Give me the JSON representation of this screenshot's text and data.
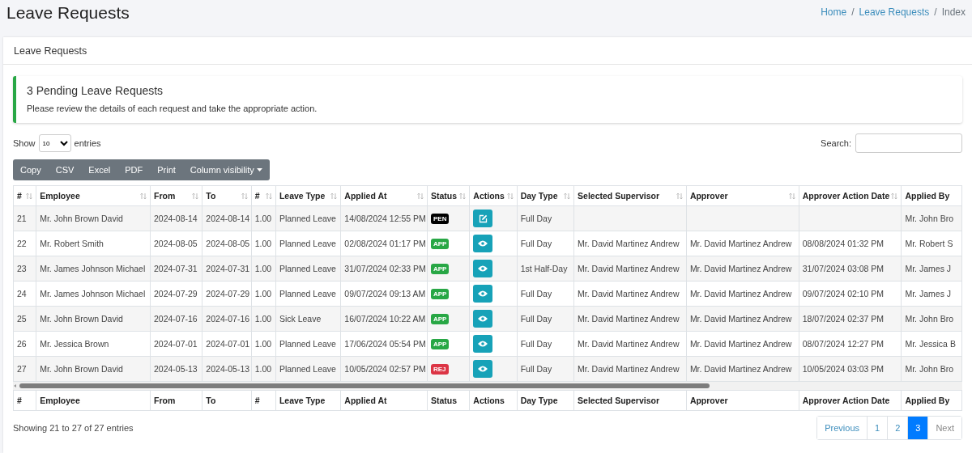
{
  "page_title": "Leave Requests",
  "breadcrumb": [
    {
      "label": "Home",
      "kind": "link"
    },
    {
      "label": "/",
      "kind": "separator"
    },
    {
      "label": "Leave Requests",
      "kind": "link"
    },
    {
      "label": "/",
      "kind": "separator"
    },
    {
      "label": "Index",
      "kind": "current"
    }
  ],
  "card": {
    "title": "Leave Requests"
  },
  "callout": {
    "title": "3 Pending Leave Requests",
    "text": "Please review the details of each request and take the appropriate action."
  },
  "length_menu": {
    "before": "Show",
    "value": "10",
    "after": "entries"
  },
  "search": {
    "label": "Search:"
  },
  "export_buttons": [
    {
      "label": "Copy",
      "kind": "plain"
    },
    {
      "label": "CSV",
      "kind": "plain"
    },
    {
      "label": "Excel",
      "kind": "plain"
    },
    {
      "label": "PDF",
      "kind": "plain"
    },
    {
      "label": "Print",
      "kind": "plain"
    },
    {
      "label": "Column visibility",
      "kind": "dropdown"
    }
  ],
  "table": {
    "columns": [
      {
        "label": "#",
        "sortable": true
      },
      {
        "label": "Employee",
        "sortable": true
      },
      {
        "label": "From",
        "sortable": true
      },
      {
        "label": "To",
        "sortable": true
      },
      {
        "label": "#",
        "sortable": true
      },
      {
        "label": "Leave Type",
        "sortable": true
      },
      {
        "label": "Applied At",
        "sortable": true
      },
      {
        "label": "Status",
        "sortable": true
      },
      {
        "label": "Actions",
        "sortable": true
      },
      {
        "label": "Day Type",
        "sortable": true
      },
      {
        "label": "Selected Supervisor",
        "sortable": true
      },
      {
        "label": "Approver",
        "sortable": true
      },
      {
        "label": "Approver Action Date",
        "sortable": true
      },
      {
        "label": "Applied By",
        "sortable": false
      }
    ],
    "rows": [
      {
        "id": "21",
        "employee": "Mr. John Brown David",
        "from": "2024-08-14",
        "to": "2024-08-14",
        "days": "1.00",
        "leave_type": "Planned Leave",
        "applied_at": "14/08/2024 12:55 PM",
        "status": {
          "label": "PEN",
          "kind": "pending"
        },
        "action": {
          "kind": "edit"
        },
        "day_type": "Full Day",
        "selected_supervisor": "",
        "approver": "",
        "approver_action_date": "",
        "applied_by": "Mr. John Bro"
      },
      {
        "id": "22",
        "employee": "Mr. Robert Smith",
        "from": "2024-08-05",
        "to": "2024-08-05",
        "days": "1.00",
        "leave_type": "Planned Leave",
        "applied_at": "02/08/2024 01:17 PM",
        "status": {
          "label": "APP",
          "kind": "approved"
        },
        "action": {
          "kind": "view"
        },
        "day_type": "Full Day",
        "selected_supervisor": "Mr. David Martinez Andrew",
        "approver": "Mr. David Martinez Andrew",
        "approver_action_date": "08/08/2024 01:32 PM",
        "applied_by": "Mr. Robert S"
      },
      {
        "id": "23",
        "employee": "Mr. James Johnson Michael",
        "from": "2024-07-31",
        "to": "2024-07-31",
        "days": "1.00",
        "leave_type": "Planned Leave",
        "applied_at": "31/07/2024 02:33 PM",
        "status": {
          "label": "APP",
          "kind": "approved"
        },
        "action": {
          "kind": "view"
        },
        "day_type": "1st Half-Day",
        "selected_supervisor": "Mr. David Martinez Andrew",
        "approver": "Mr. David Martinez Andrew",
        "approver_action_date": "31/07/2024 03:08 PM",
        "applied_by": "Mr. James J"
      },
      {
        "id": "24",
        "employee": "Mr. James Johnson Michael",
        "from": "2024-07-29",
        "to": "2024-07-29",
        "days": "1.00",
        "leave_type": "Planned Leave",
        "applied_at": "09/07/2024 09:13 AM",
        "status": {
          "label": "APP",
          "kind": "approved"
        },
        "action": {
          "kind": "view"
        },
        "day_type": "Full Day",
        "selected_supervisor": "Mr. David Martinez Andrew",
        "approver": "Mr. David Martinez Andrew",
        "approver_action_date": "09/07/2024 02:10 PM",
        "applied_by": "Mr. James J"
      },
      {
        "id": "25",
        "employee": "Mr. John Brown David",
        "from": "2024-07-16",
        "to": "2024-07-16",
        "days": "1.00",
        "leave_type": "Sick Leave",
        "applied_at": "16/07/2024 10:22 AM",
        "status": {
          "label": "APP",
          "kind": "approved"
        },
        "action": {
          "kind": "view"
        },
        "day_type": "Full Day",
        "selected_supervisor": "Mr. David Martinez Andrew",
        "approver": "Mr. David Martinez Andrew",
        "approver_action_date": "18/07/2024 02:37 PM",
        "applied_by": "Mr. John Bro"
      },
      {
        "id": "26",
        "employee": "Mr. Jessica Brown",
        "from": "2024-07-01",
        "to": "2024-07-01",
        "days": "1.00",
        "leave_type": "Planned Leave",
        "applied_at": "17/06/2024 05:54 PM",
        "status": {
          "label": "APP",
          "kind": "approved"
        },
        "action": {
          "kind": "view"
        },
        "day_type": "Full Day",
        "selected_supervisor": "Mr. David Martinez Andrew",
        "approver": "Mr. David Martinez Andrew",
        "approver_action_date": "08/07/2024 12:27 PM",
        "applied_by": "Mr. Jessica B"
      },
      {
        "id": "27",
        "employee": "Mr. John Brown David",
        "from": "2024-05-13",
        "to": "2024-05-13",
        "days": "1.00",
        "leave_type": "Planned Leave",
        "applied_at": "10/05/2024 02:57 PM",
        "status": {
          "label": "REJ",
          "kind": "rejected"
        },
        "action": {
          "kind": "view"
        },
        "day_type": "Full Day",
        "selected_supervisor": "Mr. David Martinez Andrew",
        "approver": "Mr. David Martinez Andrew",
        "approver_action_date": "10/05/2024 03:03 PM",
        "applied_by": "Mr. John Bro"
      }
    ],
    "footer_columns": [
      "#",
      "Employee",
      "From",
      "To",
      "#",
      "Leave Type",
      "Applied At",
      "Status",
      "Actions",
      "Day Type",
      "Selected Supervisor",
      "Approver",
      "Approver Action Date",
      "Applied By"
    ]
  },
  "info": "Showing 21 to 27 of 27 entries",
  "pagination": [
    {
      "label": "Previous",
      "selected": false,
      "disabled": false
    },
    {
      "label": "1",
      "selected": false,
      "disabled": false
    },
    {
      "label": "2",
      "selected": false,
      "disabled": false
    },
    {
      "label": "3",
      "selected": true,
      "disabled": false
    },
    {
      "label": "Next",
      "selected": false,
      "disabled": true
    }
  ]
}
